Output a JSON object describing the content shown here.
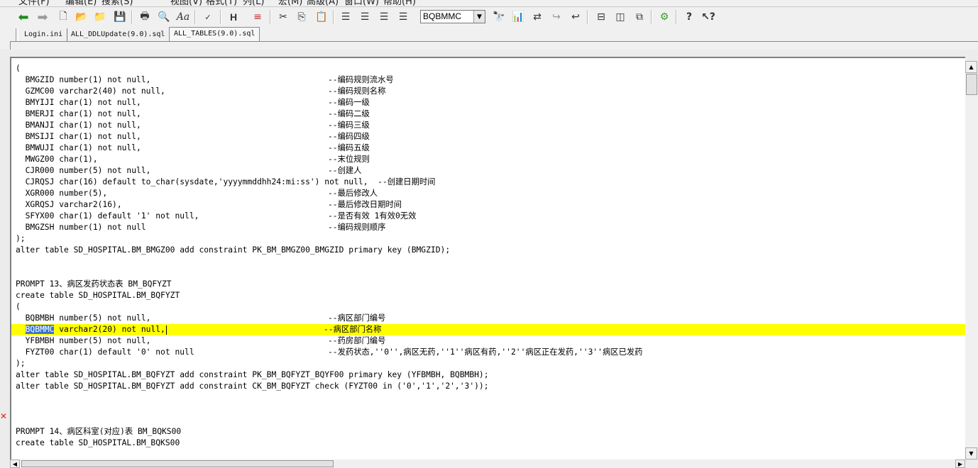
{
  "menubar": [
    "文件(F)",
    "编辑(E)",
    "搜索(S)",
    "视图(V)",
    "格式(T)",
    "列(L)",
    "宏(M)",
    "高级(A)",
    "窗口(W)",
    "帮助(H)"
  ],
  "toolbar": {
    "search_combo_value": "BQBMMC",
    "icons": [
      "back-arrow",
      "forward-arrow",
      "new-file",
      "open-file",
      "open-folder",
      "save",
      "print",
      "print-preview",
      "font",
      "spell-check",
      "header",
      "format",
      "cut",
      "copy",
      "paste",
      "align-left",
      "align-center",
      "align-right",
      "justify",
      "find",
      "find-in-files",
      "replace",
      "find-next",
      "find-previous",
      "split-horizontal",
      "split-vertical",
      "cascade",
      "macro",
      "help",
      "context-help"
    ]
  },
  "tabs": [
    {
      "label": "Login.ini",
      "active": false
    },
    {
      "label": "ALL_DDLUpdate(9.0).sql",
      "active": false
    },
    {
      "label": "ALL_TABLES(9.0).sql",
      "active": true
    }
  ],
  "editor": {
    "lines": [
      {
        "code": "(",
        "comment": ""
      },
      {
        "code": "  BMGZID number(1) not null,",
        "comment": "--编码规则流水号"
      },
      {
        "code": "  GZMC00 varchar2(40) not null,",
        "comment": "--编码规则名称"
      },
      {
        "code": "  BMYIJI char(1) not null,",
        "comment": "--编码一级"
      },
      {
        "code": "  BMERJI char(1) not null,",
        "comment": "--编码二级"
      },
      {
        "code": "  BMANJI char(1) not null,",
        "comment": "--编码三级"
      },
      {
        "code": "  BMSIJI char(1) not null,",
        "comment": "--编码四级"
      },
      {
        "code": "  BMWUJI char(1) not null,",
        "comment": "--编码五级"
      },
      {
        "code": "  MWGZ00 char(1),",
        "comment": "--末位规则"
      },
      {
        "code": "  CJR000 number(5) not null,",
        "comment": "--创建人"
      },
      {
        "code": "  CJRQSJ char(16) default to_char(sysdate,'yyyymmddhh24:mi:ss') not null,  --创建日期时间",
        "comment": ""
      },
      {
        "code": "  XGR000 number(5),",
        "comment": "--最后修改人"
      },
      {
        "code": "  XGRQSJ varchar2(16),",
        "comment": "--最后修改日期时间"
      },
      {
        "code": "  SFYX00 char(1) default '1' not null,",
        "comment": "--是否有效 1有效0无效"
      },
      {
        "code": "  BMGZSH number(1) not null",
        "comment": "--编码规则顺序"
      },
      {
        "code": ");",
        "comment": ""
      },
      {
        "code": "alter table SD_HOSPITAL.BM_BMGZ00 add constraint PK_BM_BMGZ00_BMGZID primary key (BMGZID);",
        "comment": ""
      },
      {
        "code": "",
        "comment": ""
      },
      {
        "code": "",
        "comment": ""
      },
      {
        "code": "PROMPT 13、病区发药状态表 BM_BQFYZT",
        "comment": ""
      },
      {
        "code": "create table SD_HOSPITAL.BM_BQFYZT",
        "comment": ""
      },
      {
        "code": "(",
        "comment": ""
      },
      {
        "code": "  BQBMBH number(5) not null,",
        "comment": "--病区部门编号"
      },
      {
        "code": "  BQBMMC varchar2(20) not null,",
        "comment": "--病区部门名称",
        "current": true
      },
      {
        "code": "  YFBMBH number(5) not null,",
        "comment": "--药房部门编号"
      },
      {
        "code": "  FYZT00 char(1) default '0' not null",
        "comment": "--发药状态,''0'',病区无药,''1''病区有药,''2''病区正在发药,''3''病区已发药"
      },
      {
        "code": ");",
        "comment": ""
      },
      {
        "code": "alter table SD_HOSPITAL.BM_BQFYZT add constraint PK_BM_BQFYZT_BQYF00 primary key (YFBMBH, BQBMBH);",
        "comment": ""
      },
      {
        "code": "alter table SD_HOSPITAL.BM_BQFYZT add constraint CK_BM_BQFYZT check (FYZT00 in ('0','1','2','3'));",
        "comment": ""
      },
      {
        "code": "",
        "comment": ""
      },
      {
        "code": "",
        "comment": ""
      },
      {
        "code": "",
        "comment": ""
      },
      {
        "code": "PROMPT 14、病区科室(对应)表 BM_BQKS00",
        "comment": ""
      },
      {
        "code": "create table SD_HOSPITAL.BM_BQKS00",
        "comment": ""
      }
    ],
    "selected_text": "BQBMMC"
  },
  "colors": {
    "current_line": "#ffff00",
    "selection": "#3b73d1"
  }
}
